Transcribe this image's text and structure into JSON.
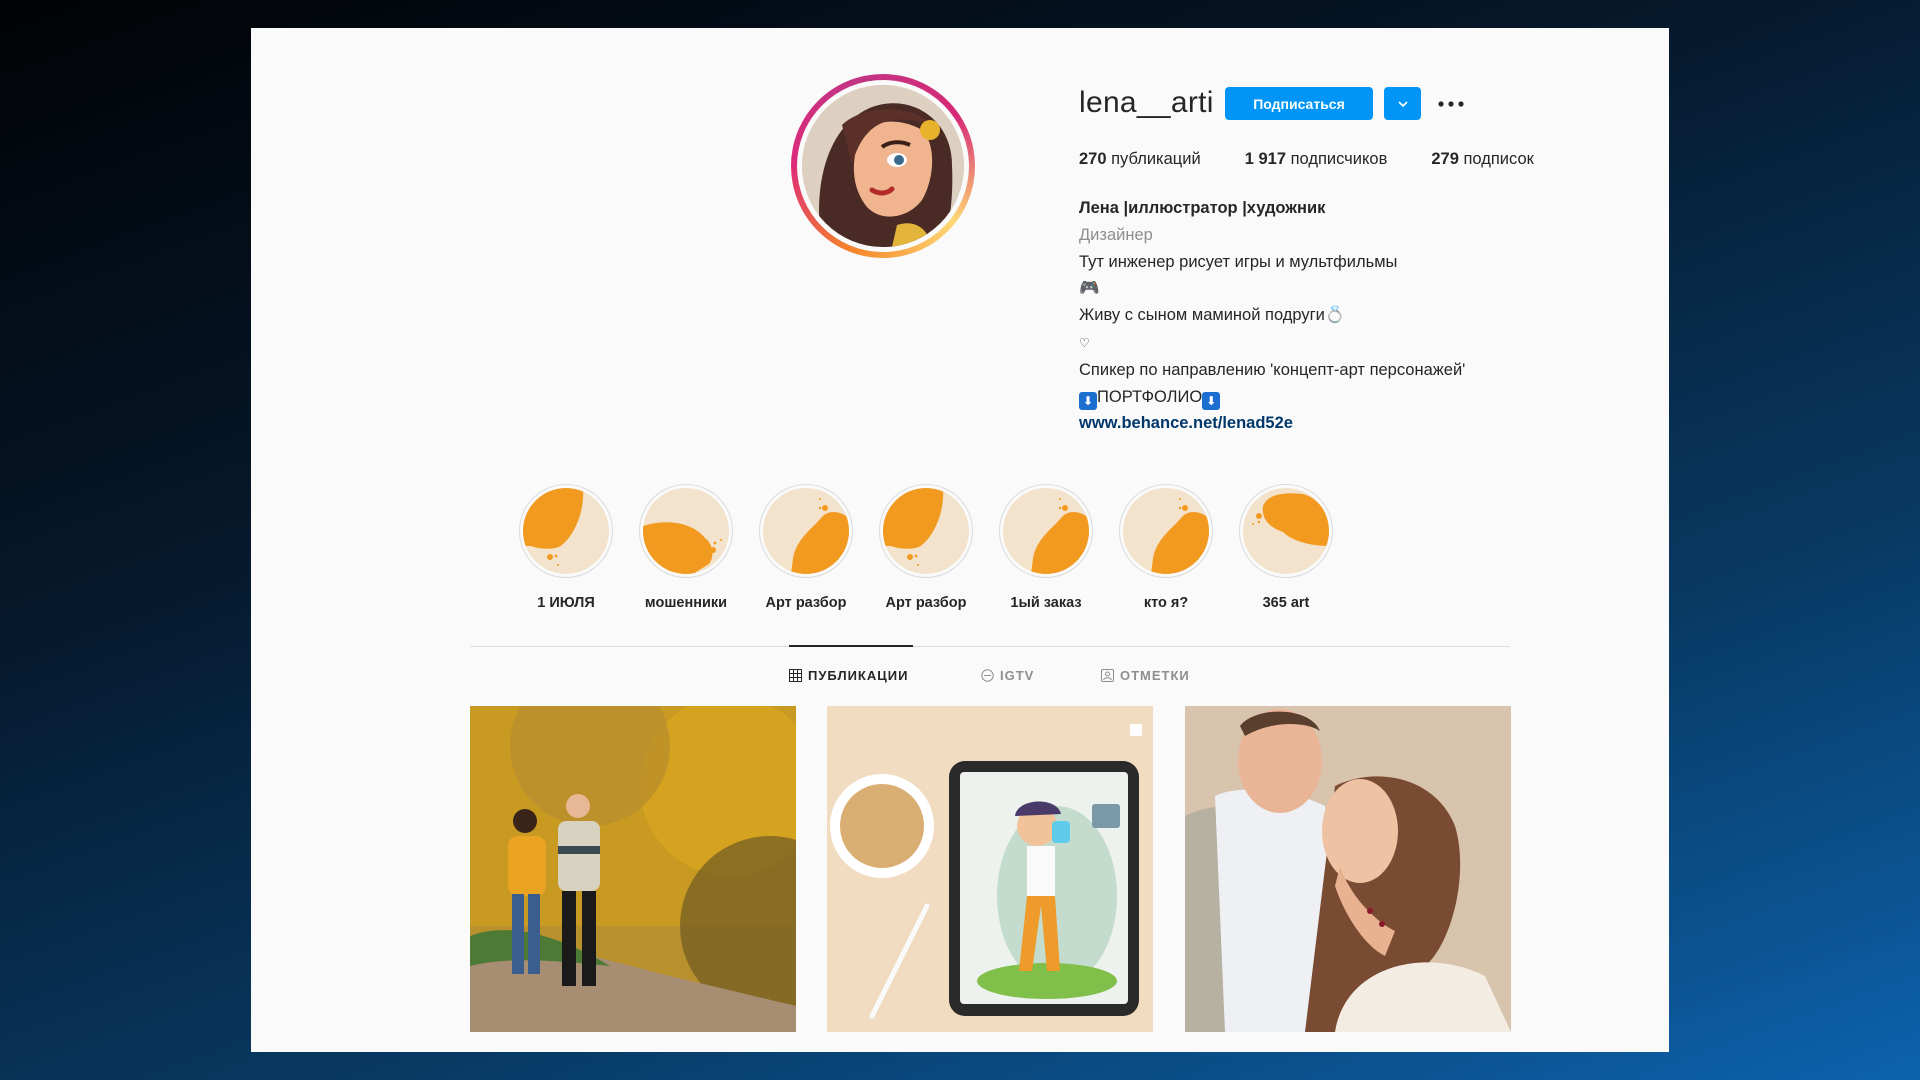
{
  "profile": {
    "username": "lena__arti",
    "follow_label": "Подписаться",
    "stats": [
      {
        "count": "270",
        "label": "публикаций"
      },
      {
        "count": "1 917",
        "label": "подписчиков"
      },
      {
        "count": "279",
        "label": "подписок"
      }
    ],
    "bio": {
      "name": "Лена |иллюстратор |художник",
      "category": "Дизайнер",
      "line1": "Тут инженер рисует игры и мультфильмы",
      "line2_emoji": "🎮",
      "line3": "Живу с сыном маминой подруги",
      "line3_emoji": "💍",
      "line4_emoji": "♡",
      "line5": "Спикер по направлению 'концепт-арт персонажей'",
      "portfolio_label": "ПОРТФОЛИО",
      "portfolio_arrow": "⬇",
      "link": "www.behance.net/lenad52e"
    }
  },
  "highlights": [
    {
      "label": "1 ИЮЛЯ",
      "shape": "top-left"
    },
    {
      "label": "мошенники",
      "shape": "bottom-left"
    },
    {
      "label": "Арт разбор",
      "shape": "bottom-right"
    },
    {
      "label": "Арт разбор",
      "shape": "top-left"
    },
    {
      "label": "1ый заказ",
      "shape": "bottom-right"
    },
    {
      "label": "кто я?",
      "shape": "bottom-right"
    },
    {
      "label": "365 art",
      "shape": "top-right"
    }
  ],
  "tabs": [
    {
      "label": "ПУБЛИКАЦИИ",
      "icon": "grid-icon",
      "active": true
    },
    {
      "label": "IGTV",
      "icon": "igtv-icon",
      "active": false
    },
    {
      "label": "ОТМЕТКИ",
      "icon": "tagged-icon",
      "active": false
    }
  ],
  "posts": [
    {
      "description": "couple walking autumn trees"
    },
    {
      "description": "tablet with cartoon drawing and coffee",
      "multi": true
    },
    {
      "description": "couple embracing portrait"
    }
  ],
  "colors": {
    "accent": "#0095f6",
    "highlight_orange": "#f29a1f",
    "highlight_bg": "#f4e3cc",
    "link": "#00376b"
  }
}
